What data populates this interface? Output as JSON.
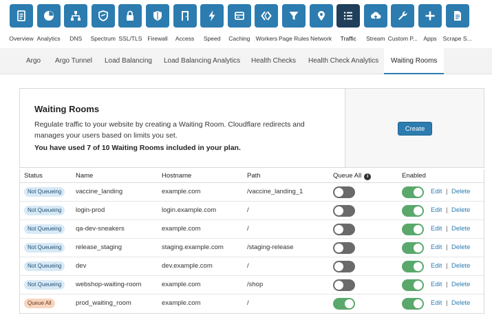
{
  "nav": {
    "items": [
      {
        "label": "Overview",
        "icon": "document-icon",
        "active": false
      },
      {
        "label": "Analytics",
        "icon": "pie-chart-icon",
        "active": false
      },
      {
        "label": "DNS",
        "icon": "network-tree-icon",
        "active": false
      },
      {
        "label": "Spectrum",
        "icon": "shield-spectrum-icon",
        "active": false
      },
      {
        "label": "SSL/TLS",
        "icon": "lock-icon",
        "active": false
      },
      {
        "label": "Firewall",
        "icon": "shield-icon",
        "active": false
      },
      {
        "label": "Access",
        "icon": "door-icon",
        "active": false
      },
      {
        "label": "Speed",
        "icon": "lightning-icon",
        "active": false
      },
      {
        "label": "Caching",
        "icon": "server-card-icon",
        "active": false
      },
      {
        "label": "Workers",
        "icon": "workers-chevrons-icon",
        "active": false
      },
      {
        "label": "Page Rules",
        "icon": "funnel-icon",
        "active": false
      },
      {
        "label": "Network",
        "icon": "location-pin-icon",
        "active": false
      },
      {
        "label": "Traffic",
        "icon": "list-icon",
        "active": true
      },
      {
        "label": "Stream",
        "icon": "cloud-upload-icon",
        "active": false
      },
      {
        "label": "Custom P...",
        "icon": "wrench-icon",
        "active": false
      },
      {
        "label": "Apps",
        "icon": "plus-icon",
        "active": false
      },
      {
        "label": "Scrape S...",
        "icon": "file-text-icon",
        "active": false
      }
    ],
    "accent": "#2c7cb0",
    "active_color": "#1f3f5a"
  },
  "tabs": [
    {
      "label": "Argo",
      "active": false
    },
    {
      "label": "Argo Tunnel",
      "active": false
    },
    {
      "label": "Load Balancing",
      "active": false
    },
    {
      "label": "Load Balancing Analytics",
      "active": false
    },
    {
      "label": "Health Checks",
      "active": false
    },
    {
      "label": "Health Check Analytics",
      "active": false
    },
    {
      "label": "Waiting Rooms",
      "active": true
    }
  ],
  "card": {
    "title": "Waiting Rooms",
    "description": "Regulate traffic to your website by creating a Waiting Room. Cloudflare redirects and manages your users based on limits you set.",
    "usage": "You have used 7 of 10 Waiting Rooms included in your plan.",
    "create_label": "Create"
  },
  "table": {
    "headers": {
      "status": "Status",
      "name": "Name",
      "hostname": "Hostname",
      "path": "Path",
      "queue_all": "Queue All",
      "enabled": "Enabled"
    },
    "edit_label": "Edit",
    "delete_label": "Delete",
    "separator": "|",
    "rows": [
      {
        "status": "Not Queueing",
        "name": "vaccine_landing",
        "hostname": "example.com",
        "path": "/vaccine_landing_1",
        "queue_all": false,
        "enabled": true
      },
      {
        "status": "Not Queueing",
        "name": "login-prod",
        "hostname": "login.example.com",
        "path": "/",
        "queue_all": false,
        "enabled": true
      },
      {
        "status": "Not Queueing",
        "name": "qa-dev-sneakers",
        "hostname": "example.com",
        "path": "/",
        "queue_all": false,
        "enabled": true
      },
      {
        "status": "Not Queueing",
        "name": "release_staging",
        "hostname": "staging.example.com",
        "path": "/staging-release",
        "queue_all": false,
        "enabled": true
      },
      {
        "status": "Not Queueing",
        "name": "dev",
        "hostname": "dev.example.com",
        "path": "/",
        "queue_all": false,
        "enabled": true
      },
      {
        "status": "Not Queueing",
        "name": "webshop-waiting-room",
        "hostname": "example.com",
        "path": "/shop",
        "queue_all": false,
        "enabled": true
      },
      {
        "status": "Queue All",
        "name": "prod_waiting_room",
        "hostname": "example.com",
        "path": "/",
        "queue_all": true,
        "enabled": true
      }
    ]
  }
}
